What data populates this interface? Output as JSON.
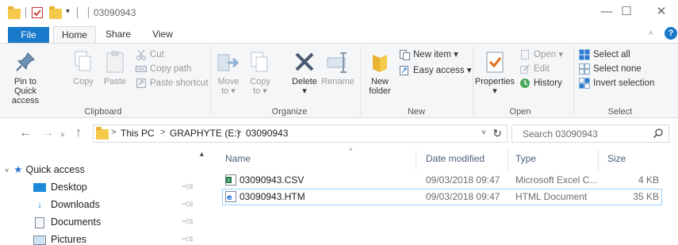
{
  "window": {
    "title": "03090943",
    "minimize": "—",
    "maximize": "☐",
    "close": "✕"
  },
  "tabs": {
    "file": "File",
    "home": "Home",
    "share": "Share",
    "view": "View"
  },
  "ribbon": {
    "clipboard": {
      "label": "Clipboard",
      "pin_line1": "Pin to Quick",
      "pin_line2": "access",
      "copy": "Copy",
      "paste": "Paste",
      "cut": "Cut",
      "copy_path": "Copy path",
      "paste_shortcut": "Paste shortcut"
    },
    "organize": {
      "label": "Organize",
      "move_to_line1": "Move",
      "move_to_line2": "to ▾",
      "copy_to_line1": "Copy",
      "copy_to_line2": "to ▾",
      "delete": "Delete",
      "delete_arrow": "▾",
      "rename": "Rename"
    },
    "new": {
      "label": "New",
      "new_folder_line1": "New",
      "new_folder_line2": "folder",
      "new_item": "New item ▾",
      "easy_access": "Easy access ▾"
    },
    "open": {
      "label": "Open",
      "properties": "Properties",
      "properties_arrow": "▾",
      "open": "Open ▾",
      "edit": "Edit",
      "history": "History"
    },
    "select": {
      "label": "Select",
      "select_all": "Select all",
      "select_none": "Select none",
      "invert_selection": "Invert selection"
    }
  },
  "address": {
    "crumbs": [
      "This PC",
      "GRAPHYTE (E:)",
      "03090943"
    ],
    "chevron": ">",
    "search_placeholder": "Search 03090943"
  },
  "nav": {
    "quick_access": "Quick access",
    "items": [
      "Desktop",
      "Downloads",
      "Documents",
      "Pictures"
    ]
  },
  "columns": {
    "name": "Name",
    "date": "Date modified",
    "type": "Type",
    "size": "Size"
  },
  "files": [
    {
      "name": "03090943.CSV",
      "date": "09/03/2018 09:47",
      "type": "Microsoft Excel C...",
      "size": "4 KB"
    },
    {
      "name": "03090943.HTM",
      "date": "09/03/2018 09:47",
      "type": "HTML Document",
      "size": "35 KB"
    }
  ],
  "colors": {
    "accent": "#1979ca",
    "selection_border": "#99d1ff",
    "ribbon_bg": "#f5f6f7"
  }
}
